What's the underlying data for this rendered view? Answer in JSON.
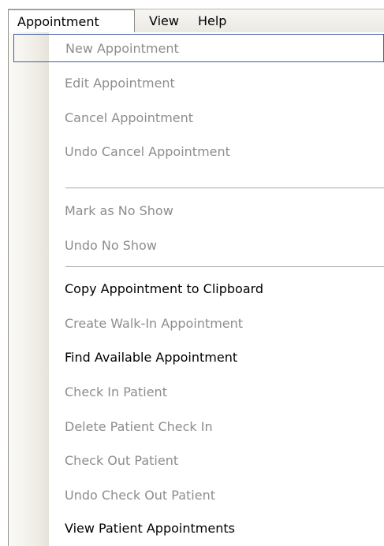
{
  "menubar": {
    "items": [
      {
        "label": "Appointment",
        "active": true
      },
      {
        "label": "View",
        "active": false
      },
      {
        "label": "Help",
        "active": false
      }
    ]
  },
  "menu": {
    "items": [
      {
        "label": "New Appointment",
        "enabled": false,
        "focused": true
      },
      {
        "label": "Edit Appointment",
        "enabled": false
      },
      {
        "label": "Cancel Appointment",
        "enabled": false
      },
      {
        "label": "Undo Cancel Appointment",
        "enabled": false
      },
      {
        "separator": true
      },
      {
        "label": "Mark as No Show",
        "enabled": false
      },
      {
        "label": "Undo No Show",
        "enabled": false
      },
      {
        "separator": true
      },
      {
        "label": "Copy  Appointment to Clipboard",
        "enabled": true
      },
      {
        "label": "Create Walk-In Appointment",
        "enabled": false
      },
      {
        "label": "Find Available Appointment",
        "enabled": true
      },
      {
        "label": "Check In Patient",
        "enabled": false
      },
      {
        "label": "Delete Patient Check In",
        "enabled": false
      },
      {
        "label": "Check Out Patient",
        "enabled": false
      },
      {
        "label": "Undo Check Out Patient",
        "enabled": false
      },
      {
        "label": "View Patient Appointments",
        "enabled": true
      }
    ]
  },
  "colors": {
    "enabled_text": "#000000",
    "disabled_text": "#8d8d8d",
    "focus_border": "#3f5ea6"
  }
}
